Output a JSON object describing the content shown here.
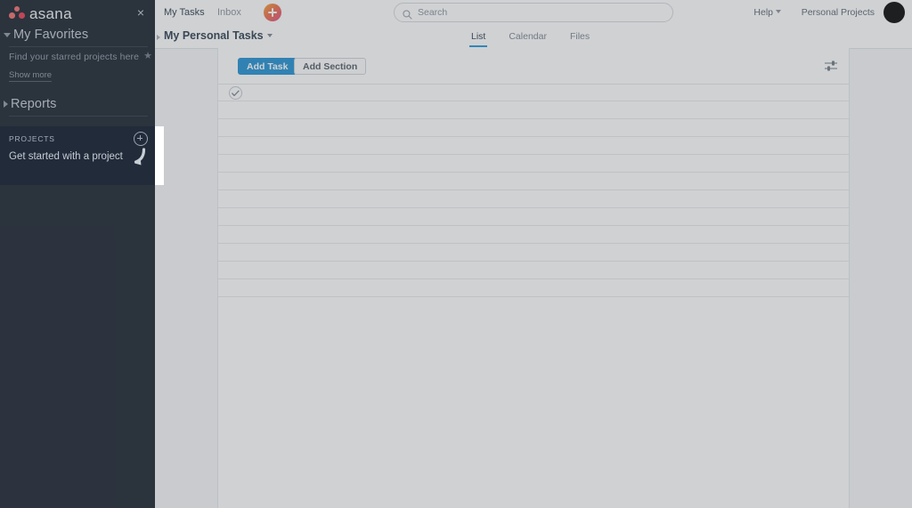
{
  "app": {
    "name": "Asana"
  },
  "sidebar": {
    "logo_text": "asana",
    "close_icon": "×",
    "favorites": {
      "title": "My Favorites",
      "hint": "Find your starred projects here",
      "star_icon": "★",
      "show_more": "Show more"
    },
    "reports": {
      "title": "Reports"
    },
    "projects": {
      "label": "PROJECTS",
      "add_title": "Add project",
      "item": "Get started with a project"
    }
  },
  "topbar": {
    "my_tasks": "My Tasks",
    "inbox": "Inbox",
    "quick_add_title": "Quick add",
    "search": {
      "placeholder": "Search",
      "value": ""
    },
    "help": "Help",
    "workspace": "Personal Projects",
    "avatar_label": ""
  },
  "subheader": {
    "page_title": "My Personal Tasks",
    "tabs": [
      {
        "label": "List",
        "active": true
      },
      {
        "label": "Calendar",
        "active": false
      },
      {
        "label": "Files",
        "active": false
      }
    ]
  },
  "toolbar": {
    "add_task": "Add Task",
    "add_section": "Add Section",
    "filter_title": "Sort and filter"
  },
  "task_list": {
    "rows": [
      {
        "has_checkbox": true,
        "text": ""
      },
      {
        "has_checkbox": false,
        "text": ""
      },
      {
        "has_checkbox": false,
        "text": ""
      },
      {
        "has_checkbox": false,
        "text": ""
      },
      {
        "has_checkbox": false,
        "text": ""
      },
      {
        "has_checkbox": false,
        "text": ""
      },
      {
        "has_checkbox": false,
        "text": ""
      },
      {
        "has_checkbox": false,
        "text": ""
      },
      {
        "has_checkbox": false,
        "text": ""
      },
      {
        "has_checkbox": false,
        "text": ""
      },
      {
        "has_checkbox": false,
        "text": ""
      },
      {
        "has_checkbox": false,
        "text": ""
      }
    ]
  },
  "colors": {
    "sidebar_bg": "#151d29",
    "sidebar_highlight_bg": "#212b3a",
    "accent_blue": "#1d8fd1",
    "logo_red": "#f06a6a",
    "dim_overlay": "rgba(96,102,110,0.30)"
  }
}
